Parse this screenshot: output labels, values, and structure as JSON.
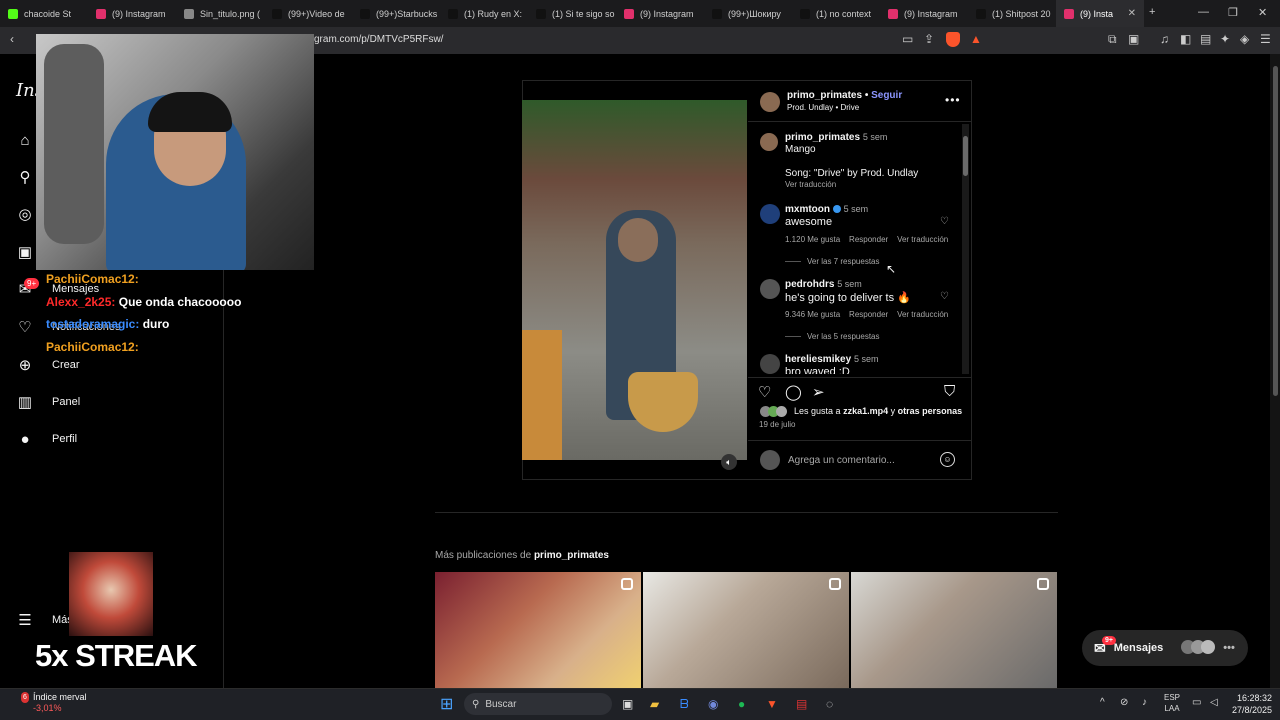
{
  "browser": {
    "tabs": [
      {
        "label": "chacoide St",
        "color": "#53fc18"
      },
      {
        "label": "(9) Instagram",
        "color": "#e1306c"
      },
      {
        "label": "Sin_titulo.png (",
        "color": "#888888"
      },
      {
        "label": "(99+)Video de",
        "color": "#111111"
      },
      {
        "label": "(99+)Starbucks",
        "color": "#111111"
      },
      {
        "label": "(1) Rudy en X:",
        "color": "#111111"
      },
      {
        "label": "(1) Si te sigo so",
        "color": "#111111"
      },
      {
        "label": "(9) Instagram",
        "color": "#e1306c"
      },
      {
        "label": "(99+)Шокиру",
        "color": "#111111"
      },
      {
        "label": "(1) no context",
        "color": "#111111"
      },
      {
        "label": "(9) Instagram",
        "color": "#e1306c"
      },
      {
        "label": "(1) Shitpost 20",
        "color": "#111111"
      },
      {
        "label": "(9) Insta",
        "color": "#e1306c",
        "active": true
      }
    ],
    "new_tab": "+",
    "url": "gram.com/p/DMTVcP5RFsw/",
    "brave_count": "1"
  },
  "sidebar": {
    "logo": "Ins",
    "items": [
      {
        "label": "",
        "icon": "home-icon",
        "glyph": "⌂"
      },
      {
        "label": "",
        "icon": "search-icon",
        "glyph": "⚲"
      },
      {
        "label": "",
        "icon": "explore-icon",
        "glyph": "◎"
      },
      {
        "label": "",
        "icon": "reels-icon",
        "glyph": "▣"
      },
      {
        "label": "Mensajes",
        "icon": "messenger-icon",
        "glyph": "✉"
      },
      {
        "label": "Notificaciones",
        "icon": "heart-icon",
        "glyph": "♡"
      },
      {
        "label": "Crear",
        "icon": "plus-icon",
        "glyph": "⊕"
      },
      {
        "label": "Panel",
        "icon": "dashboard-icon",
        "glyph": "▥"
      },
      {
        "label": "Perfil",
        "icon": "profile-icon",
        "glyph": "●"
      },
      {
        "label": "Más",
        "icon": "menu-icon",
        "glyph": "☰"
      }
    ],
    "mensajes_badge": "9+"
  },
  "stream_overlay": {
    "chat": [
      {
        "user": "PachiiComac12:",
        "message": "",
        "user_color": "#f0a020"
      },
      {
        "user": "Alexx_2k25:",
        "message": "Que onda chacooooo",
        "user_color": "#ff2a2a"
      },
      {
        "user": "tostadoramagic:",
        "message": "duro",
        "user_color": "#3a8cff"
      },
      {
        "user": "PachiiComac12:",
        "message": "",
        "user_color": "#f0a020"
      }
    ],
    "streak_text": "5x STREAK"
  },
  "post": {
    "author": "primo_primates",
    "follow": "Seguir",
    "audio": "Prod. Undlay • Drive",
    "caption_author": "primo_primates",
    "caption_time": "5 sem",
    "caption_line1": "Mango",
    "caption_line2": "Song: \"Drive\" by Prod. Undlay",
    "caption_translate": "Ver traducción",
    "comments": [
      {
        "user": "mxmtoon",
        "time": "5 sem",
        "text": "awesome",
        "likes": "1.120 Me gusta",
        "reply": "Responder",
        "translate": "Ver traducción",
        "replies": "Ver las 7 respuestas",
        "verified": true
      },
      {
        "user": "pedrohdrs",
        "time": "5 sem",
        "text": "he's going to deliver ts 🔥",
        "likes": "9.346 Me gusta",
        "reply": "Responder",
        "translate": "Ver traducción",
        "replies": "Ver las 5 respuestas",
        "verified": false
      },
      {
        "user": "hereliesmikey",
        "time": "5 sem",
        "text": "bro waved :D",
        "verified": false
      }
    ],
    "likes_prefix": "Les gusta a",
    "likes_user": "zzka1.mp4",
    "likes_mid": "y",
    "likes_others": "otras personas",
    "date": "19 de julio",
    "comment_placeholder": "Agrega un comentario..."
  },
  "more_posts": {
    "prefix": "Más publicaciones de",
    "user": "primo_primates"
  },
  "messages_pill": {
    "label": "Mensajes",
    "badge": "9+"
  },
  "taskbar": {
    "weather_title": "Índice merval",
    "weather_value": "-3,01%",
    "weather_badge": "6",
    "search_placeholder": "Buscar",
    "lang_line1": "ESP",
    "lang_line2": "LAA",
    "time": "16:28:32",
    "date": "27/8/2025"
  }
}
